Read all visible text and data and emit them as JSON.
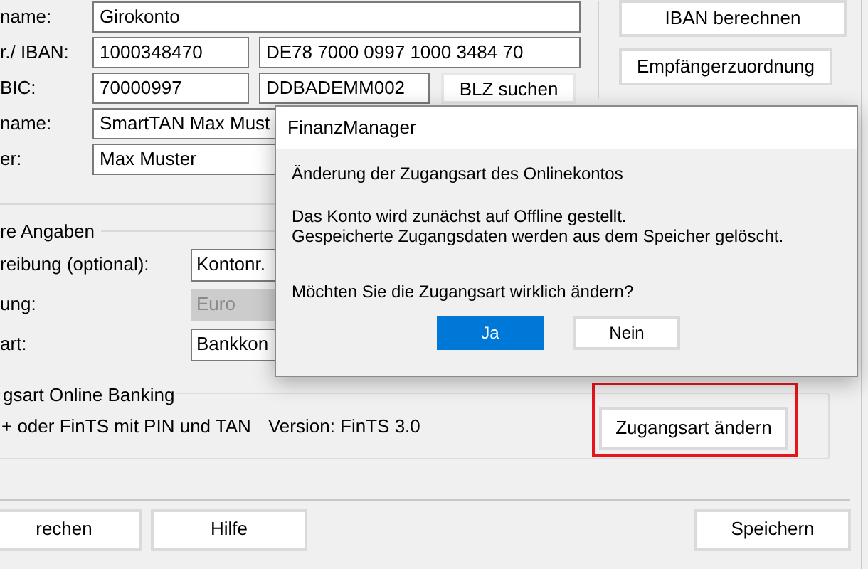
{
  "account_form": {
    "rows": [
      {
        "label": "name:",
        "items": [
          {
            "kind": "field",
            "text": "Girokonto"
          }
        ]
      },
      {
        "label": "r./ IBAN:",
        "items": [
          {
            "kind": "field",
            "text": "1000348470"
          },
          {
            "kind": "field",
            "text": "DE78 7000 0997 1000 3484 70"
          }
        ]
      },
      {
        "label": "BIC:",
        "items": [
          {
            "kind": "field",
            "text": "70000997"
          },
          {
            "kind": "field",
            "text": "DDBADEMM002"
          },
          {
            "kind": "button",
            "text": "BLZ suchen"
          }
        ]
      },
      {
        "label": "name:",
        "items": [
          {
            "kind": "field",
            "text": "SmartTAN Max Must"
          }
        ]
      },
      {
        "label": "er:",
        "items": [
          {
            "kind": "field",
            "text": "Max Muster"
          }
        ]
      }
    ],
    "side_buttons": [
      "IBAN berechnen",
      "Empfängerzuordnung"
    ]
  },
  "more_details": {
    "title": "re Angaben",
    "rows": [
      {
        "label": "reibung (optional):",
        "value": "Kontonr.",
        "disabled": false
      },
      {
        "label": "ung:",
        "value": "Euro",
        "disabled": true
      },
      {
        "label": "art:",
        "value": "Bankkon",
        "disabled": false
      }
    ]
  },
  "online_banking": {
    "title": "gsart Online Banking",
    "method": "+ oder FinTS mit PIN und TAN",
    "version": "Version: FinTS 3.0",
    "change_button": {
      "label": "Zugangsart ändern",
      "highlighted": true
    }
  },
  "footer_buttons": [
    {
      "label": "rechen"
    },
    {
      "label": "Hilfe"
    },
    {
      "label": "Speichern"
    }
  ],
  "dialog": {
    "title": "FinanzManager",
    "heading": "Änderung der Zugangsart des Onlinekontos",
    "lines": [
      "Das Konto wird zunächst auf Offline gestellt.",
      "Gespeicherte Zugangsdaten werden aus dem Speicher gelöscht."
    ],
    "question": "Möchten Sie die Zugangsart wirklich ändern?",
    "buttons": [
      {
        "label": "Ja",
        "default": true
      },
      {
        "label": "Nein",
        "default": false
      }
    ]
  }
}
